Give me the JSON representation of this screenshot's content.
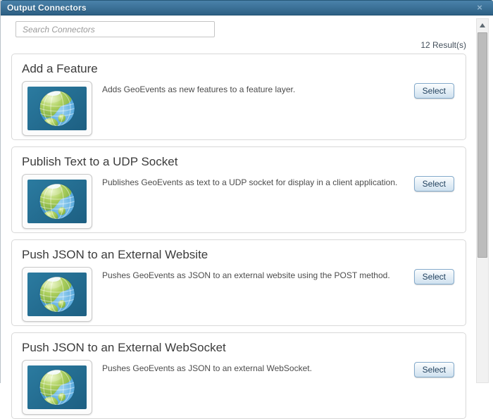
{
  "dialog": {
    "title": "Output Connectors",
    "close_icon": "×"
  },
  "search": {
    "placeholder": "Search Connectors",
    "value": ""
  },
  "results_count": "12 Result(s)",
  "colors": {
    "header_top": "#4a82aa",
    "header_bottom": "#2d6084",
    "button_border": "#84aacb",
    "button_text": "#1f3f5c",
    "thumb_background": "#236c90"
  },
  "connectors": [
    {
      "title": "Add a Feature",
      "description": "Adds GeoEvents as new features to a feature layer.",
      "select_label": "Select",
      "icon": "globe-icon"
    },
    {
      "title": "Publish Text to a UDP Socket",
      "description": "Publishes GeoEvents as text to a UDP socket for display in a client application.",
      "select_label": "Select",
      "icon": "globe-icon"
    },
    {
      "title": "Push JSON to an External Website",
      "description": "Pushes GeoEvents as JSON to an external website using the POST method.",
      "select_label": "Select",
      "icon": "globe-icon"
    },
    {
      "title": "Push JSON to an External WebSocket",
      "description": "Pushes GeoEvents as JSON to an external WebSocket.",
      "select_label": "Select",
      "icon": "globe-icon"
    }
  ]
}
